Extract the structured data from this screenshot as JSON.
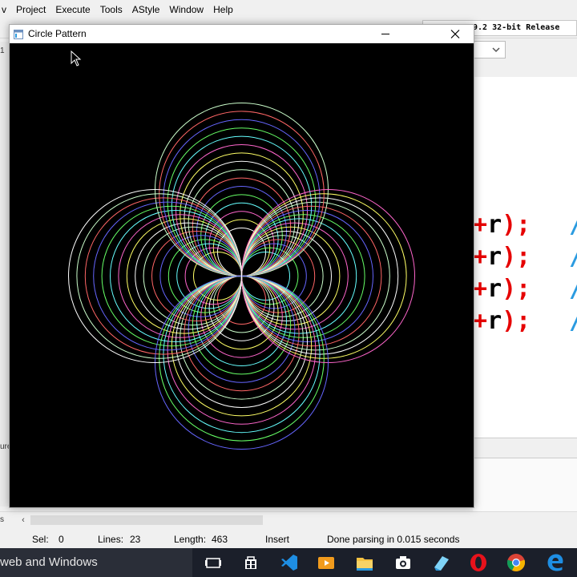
{
  "menubar": {
    "items": [
      {
        "label": "v"
      },
      {
        "label": "Project"
      },
      {
        "label": "Execute"
      },
      {
        "label": "Tools"
      },
      {
        "label": "AStyle"
      },
      {
        "label": "Window"
      },
      {
        "label": "Help"
      }
    ]
  },
  "toolbar": {
    "compiler_info": "9.2 32-bit Release"
  },
  "left_panel": {
    "clip_top": "1",
    "clip_mid": "ure",
    "clip_bottom": "s"
  },
  "editor": {
    "lines": [
      {
        "plus": "+",
        "r": "r",
        "paren": ");",
        "comment": "/"
      },
      {
        "plus": "+",
        "r": "r",
        "paren": ");",
        "comment": "/"
      },
      {
        "plus": "+",
        "r": "r",
        "paren": ");",
        "comment": "/"
      },
      {
        "plus": "+",
        "r": "r",
        "paren": ");",
        "comment": "/"
      }
    ]
  },
  "statusbar": {
    "sel_label": "Sel:",
    "sel_value": "0",
    "lines_label": "Lines:",
    "lines_value": "23",
    "length_label": "Length:",
    "length_value": "463",
    "mode": "Insert",
    "message": "Done parsing in 0.015 seconds"
  },
  "taskbar": {
    "search_text": "web and Windows",
    "icons": [
      "task-view-icon",
      "store-icon",
      "visual-studio-code-icon",
      "media-player-icon",
      "file-explorer-icon",
      "camera-icon",
      "paint-icon",
      "opera-icon",
      "chrome-icon",
      "edge-icon"
    ]
  },
  "window": {
    "title": "Circle Pattern",
    "colors": {
      "background": "#000000",
      "palette": [
        "#ffffff",
        "#ffff66",
        "#ff66cc",
        "#66ffff",
        "#66ff66",
        "#6666ff",
        "#ff6666",
        "#ccffcc"
      ]
    }
  }
}
